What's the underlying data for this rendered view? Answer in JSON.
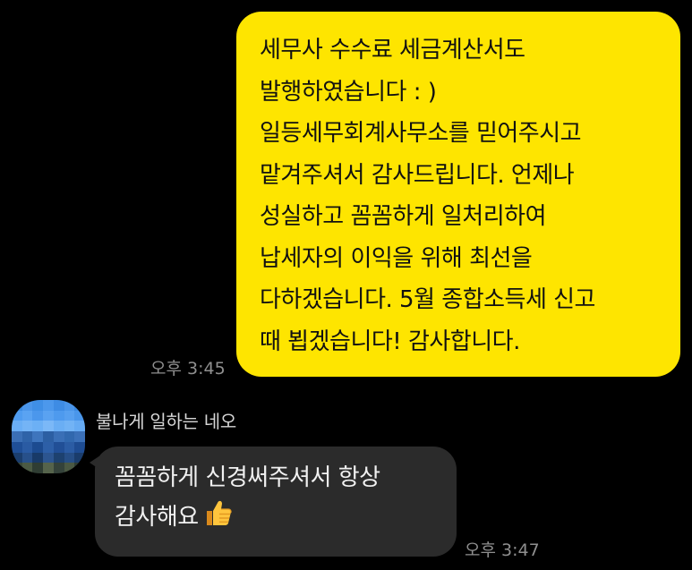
{
  "outgoing": {
    "lines": [
      "세무사 수수료 세금계산서도",
      "발행하였습니다 : )",
      "일등세무회계사무소를 믿어주시고",
      "맡겨주셔서 감사드립니다. 언제나",
      "성실하고 꼼꼼하게 일처리하여",
      "납세자의 이익을 위해 최선을",
      "다하겠습니다. 5월 종합소득세 신고",
      "때 뵙겠습니다! 감사합니다."
    ],
    "time": "오후 3:45"
  },
  "incoming": {
    "sender": "불나게 일하는 네오",
    "lines": [
      "꼼꼼하게 신경써주셔서 항상",
      "감사해요"
    ],
    "emoji": "thumbs-up-icon",
    "time": "오후 3:47"
  },
  "colors": {
    "background": "#000000",
    "outgoing_bubble": "#FEE500",
    "incoming_bubble": "#2B2B2B",
    "time_text": "#8F8F8F"
  }
}
